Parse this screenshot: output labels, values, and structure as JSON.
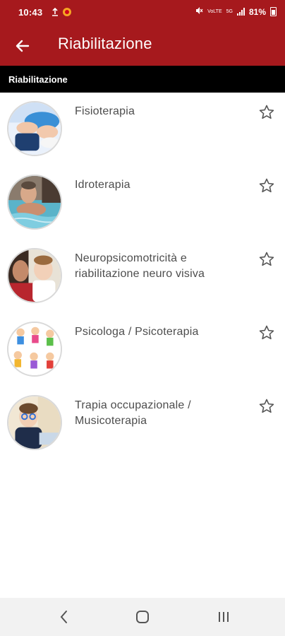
{
  "status_bar": {
    "time": "10:43",
    "battery_percent": "81%",
    "network_label_top": "VoLTE",
    "network_label_bottom": "5G",
    "icons": [
      "upload-icon",
      "app-notification-icon",
      "mute-icon",
      "wifi-calling-icon",
      "signal-icon",
      "battery-icon"
    ]
  },
  "app_bar": {
    "title": "Riabilitazione",
    "back_icon": "arrow-left-icon",
    "color": "#a6191d"
  },
  "section": {
    "header": "Riabilitazione"
  },
  "items": [
    {
      "title": "Fisioterapia",
      "image": "physiotherapy-photo",
      "starred": false
    },
    {
      "title": "Idroterapia",
      "image": "hydrotherapy-photo",
      "starred": false
    },
    {
      "title": "Neuropsicomotricità e riabilitazione neuro visiva",
      "image": "child-therapy-photo",
      "starred": false
    },
    {
      "title": "Psicologa / Psicoterapia",
      "image": "cartoon-children-illustration",
      "starred": false
    },
    {
      "title": "Trapia occupazionale / Musicoterapia",
      "image": "child-with-glasses-photo",
      "starred": false
    }
  ],
  "nav_bar": {
    "icons": [
      "back-nav-icon",
      "home-nav-icon",
      "recents-nav-icon"
    ]
  }
}
